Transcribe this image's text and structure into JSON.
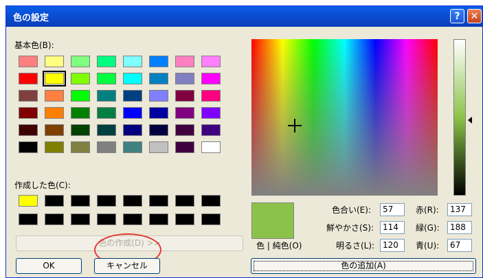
{
  "dialog": {
    "title": "色の設定",
    "help_label": "?",
    "close_label": "✕"
  },
  "basic_colors": {
    "label": "基本色(B):",
    "selected_index": 9,
    "colors": [
      "#ff8080",
      "#ffff80",
      "#80ff80",
      "#00ff80",
      "#80ffff",
      "#0080ff",
      "#ff80c0",
      "#ff80ff",
      "#ff0000",
      "#ffff00",
      "#80ff00",
      "#00ff40",
      "#00ffff",
      "#0080c0",
      "#8080c0",
      "#ff00ff",
      "#804040",
      "#ff8040",
      "#00ff00",
      "#008080",
      "#004080",
      "#8080ff",
      "#800040",
      "#ff0080",
      "#800000",
      "#ff8000",
      "#008000",
      "#008040",
      "#0000ff",
      "#0000a0",
      "#800080",
      "#8000ff",
      "#400000",
      "#804000",
      "#004000",
      "#004040",
      "#000080",
      "#000040",
      "#400040",
      "#400080",
      "#000000",
      "#808000",
      "#808040",
      "#808080",
      "#408080",
      "#c0c0c0",
      "#400040",
      "#ffffff"
    ]
  },
  "custom_colors": {
    "label": "作成した色(C):",
    "colors": [
      "#ffff00",
      "#000000",
      "#000000",
      "#000000",
      "#000000",
      "#000000",
      "#000000",
      "#000000",
      "#000000",
      "#000000",
      "#000000",
      "#000000",
      "#000000",
      "#000000",
      "#000000",
      "#000000"
    ]
  },
  "buttons": {
    "define_custom": "色の作成(D) >>",
    "ok": "OK",
    "cancel": "キャンセル",
    "add_custom": "色の追加(A)"
  },
  "preview": {
    "color": "#8bc34a",
    "label": "色 | 純色(O)"
  },
  "fields": {
    "hue": {
      "label": "色合い(E):",
      "value": "57"
    },
    "sat": {
      "label": "鮮やかさ(S):",
      "value": "114"
    },
    "lum": {
      "label": "明るさ(L):",
      "value": "120"
    },
    "red": {
      "label": "赤(R):",
      "value": "137"
    },
    "green": {
      "label": "緑(G):",
      "value": "188"
    },
    "blue": {
      "label": "青(U):",
      "value": "67"
    }
  }
}
